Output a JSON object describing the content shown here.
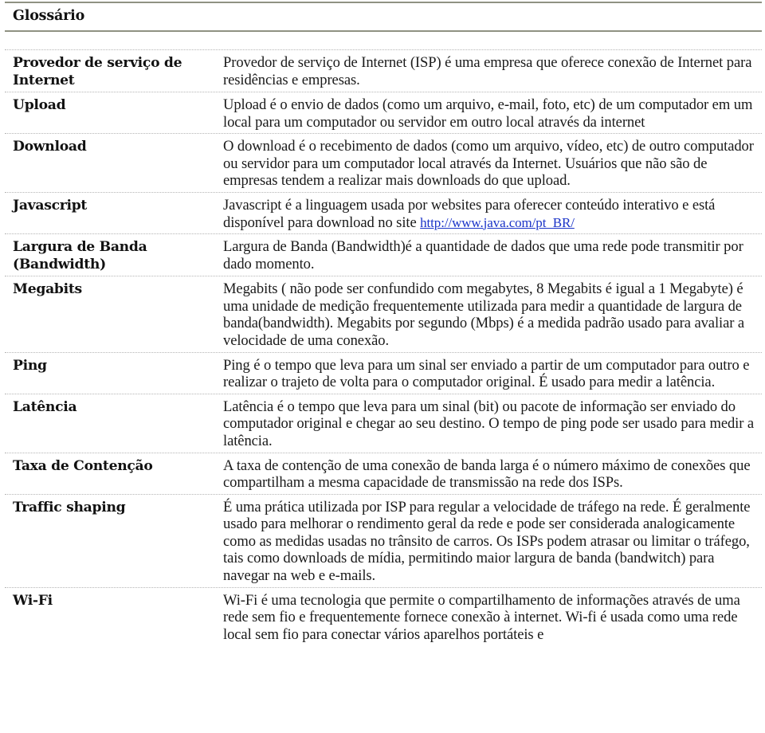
{
  "document": {
    "title": "Glossário",
    "accent_colors": {
      "rule_line": "#8f9282",
      "row_separator": "#b5b5b5",
      "link": "#1a33c8"
    },
    "entries": [
      {
        "term": "Provedor de serviço de Internet",
        "definition": "Provedor de serviço de Internet  (ISP) é uma empresa que oferece conexão de Internet para residências e empresas."
      },
      {
        "term": "Upload",
        "definition": "Upload é o envio de dados (como um arquivo, e-mail, foto, etc) de um computador em um local para um computador ou servidor em outro local através da internet"
      },
      {
        "term": "Download",
        "definition": "O download é o recebimento de dados (como um arquivo, vídeo, etc) de outro computador ou servidor para um computador local através da Internet. Usuários que não são de empresas tendem a realizar mais downloads do que upload."
      },
      {
        "term": "Javascript",
        "definition": "Javascript é a linguagem usada por websites para oferecer conteúdo interativo e está disponível para download no site ",
        "link": "http://www.java.com/pt_BR/"
      },
      {
        "term": "Largura de Banda (Bandwidth)",
        "definition": "Largura de Banda (Bandwidth)é a quantidade de dados que uma rede pode transmitir por dado momento."
      },
      {
        "term": "Megabits",
        "definition": "Megabits ( não pode ser confundido com megabytes, 8 Megabits é igual a 1 Megabyte) é uma unidade de medição frequentemente utilizada para medir a quantidade de largura de banda(bandwidth). Megabits por segundo (Mbps) é a medida padrão usado para avaliar a velocidade de uma conexão."
      },
      {
        "term": "Ping",
        "definition": "Ping é o tempo que leva para um sinal ser enviado a partir de um computador para outro e realizar o trajeto de volta para o computador original. É usado para medir a latência."
      },
      {
        "term": "Latência",
        "definition": "Latência é o tempo que leva para um sinal (bit) ou pacote de informação ser enviado do computador original e chegar ao seu destino. O tempo de ping pode ser usado para medir a latência."
      },
      {
        "term": "Taxa de Contenção",
        "definition": "A taxa de contenção de uma conexão de banda larga é o número máximo de conexões que compartilham a mesma capacidade de transmissão na rede dos ISPs."
      },
      {
        "term": "Traffic shaping",
        "definition": "É uma prática utilizada por ISP para regular a velocidade de tráfego na rede. É geralmente usado para melhorar o rendimento geral da rede e pode ser considerada analogicamente como as medidas usadas no trânsito de carros. Os ISPs podem atrasar ou limitar o tráfego, tais como downloads de mídia, permitindo maior largura de banda (bandwitch) para navegar na web e e-mails."
      },
      {
        "term": "Wi-Fi",
        "definition": "Wi-Fi é uma tecnologia que permite o compartilhamento de informações através de uma rede sem fio e frequentemente fornece conexão à internet. Wi-fi é usada como uma rede local sem fio para conectar vários aparelhos portáteis e"
      }
    ]
  }
}
